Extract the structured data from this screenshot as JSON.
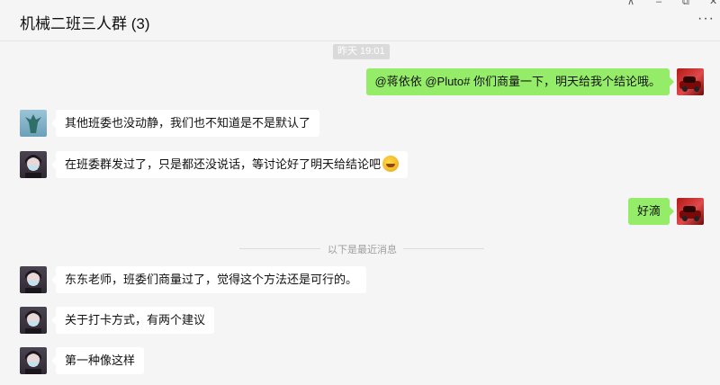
{
  "window": {
    "title": "机械二班三人群 (3)",
    "controls": {
      "pin": "⊼",
      "minimize": "–",
      "maximize": "⧉",
      "close": "✕"
    },
    "more_label": "···"
  },
  "chat": {
    "time_divider": "昨天 19:01",
    "new_messages_divider": "以下是最近消息",
    "messages": [
      {
        "side": "right",
        "sender": "me",
        "text": "@蒋依依 @Pluto# 你们商量一下，明天给我个结论哦。"
      },
      {
        "side": "left",
        "sender": "dragon",
        "text": "其他班委也没动静，我们也不知道是不是默认了"
      },
      {
        "side": "left",
        "sender": "girl",
        "text": "在班委群发过了，只是都还没说话，等讨论好了明天给结论吧",
        "emoji": "facepalm-emoji"
      },
      {
        "side": "right",
        "sender": "me",
        "text": "好滴"
      },
      {
        "side": "left",
        "sender": "girl",
        "text": "东东老师，班委们商量过了，觉得这个方法还是可行的。"
      },
      {
        "side": "left",
        "sender": "girl",
        "text": "关于打卡方式，有两个建议"
      },
      {
        "side": "left",
        "sender": "girl",
        "text": "第一种像这样"
      }
    ]
  },
  "colors": {
    "background": "#f5f5f5",
    "bubble_self": "#95ec69",
    "bubble_other": "#ffffff",
    "time_badge": "#dadada"
  }
}
